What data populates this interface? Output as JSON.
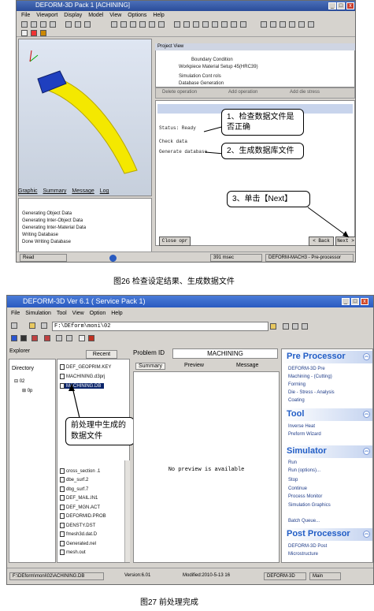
{
  "fig26": {
    "title": "DEFORM-3D  Pack  1  [ACHINING]",
    "menu": [
      "File",
      "Viewport",
      "Display",
      "Model",
      "View",
      "Options",
      "Help"
    ],
    "project_view": {
      "header": "Project View",
      "lines": [
        "Boundary  Condition",
        "Workpiece  Material  Setup  45(HRC39)",
        "Simulation  Cont  rols",
        "Database  Generation"
      ]
    },
    "op_bar": [
      "Delete operation",
      "Add operation",
      "Add die stress"
    ],
    "wizard": {
      "status_label": "Status: Ready",
      "check_label": "Check data",
      "generate_label": "Generate database"
    },
    "callouts": [
      "1、检查数据文件是否正确",
      "2、生成数据库文件",
      "3、单击【Next】"
    ],
    "tabs": [
      "Graphic",
      "Summary",
      "Message",
      "Log"
    ],
    "messages": [
      "Generating  Object  Data",
      "Generating  Inter-Object  Data",
      "Generating  Inter-Material  Data",
      "Writing  Database",
      "Done  Writing  Database"
    ],
    "buttons": {
      "close": "Close opr",
      "back": "< Back",
      "next": "Next >"
    },
    "status": {
      "left": "Read",
      "speed": "391 msec",
      "right": "DEFORM-MACH3  -  Pre-processor"
    },
    "caption": "图26  检查设定结果、生成数据文件"
  },
  "fig27": {
    "title": "DEFORM-3D  Ver  6.1 (  Service  Pack  1)",
    "menu": [
      "File",
      "Simulation",
      "Tool",
      "View",
      "Option",
      "Help"
    ],
    "path": "F:\\DEform\\moni\\02",
    "left_tabs": [
      "Explorer",
      "Recent"
    ],
    "tree_header": "Directory",
    "tree_items": [
      "02",
      "0p"
    ],
    "files_top": [
      "DEF_GEOPRIM.KEY",
      "MACHINING.d3prj",
      "MACHINING.DB"
    ],
    "files_bottom": [
      "cross_section  .1",
      "dbe_surf.2",
      "dbg_surf.7",
      "DEF_MAIL.IN1",
      "DEF_MGN.ACT",
      "DEFORMID.PROB",
      "DENSTY.DST",
      "fmesh3d.dat.D",
      "Generated.nel",
      "mesh.out"
    ],
    "callout": "前处理中生成的数据文件",
    "problem_id_label": "Problem ID",
    "problem_id_value": "MACHINING",
    "center_tabs": [
      "Summary",
      "Preview",
      "Message"
    ],
    "no_preview": "No preview is available",
    "right_sections": [
      {
        "title": "Pre Processor",
        "items": [
          "DEFORM-3D Pre",
          "Machining - (Cutting)",
          "Forming",
          "Die - Stress - Analysis",
          "Coating"
        ]
      },
      {
        "title": "Tool",
        "items": [
          "Inverse  Heat",
          "Preform  Wizard"
        ]
      },
      {
        "title": "Simulator",
        "items": [
          "Run",
          "Run (options)...",
          "Stop",
          "Continue",
          "Process  Monitor",
          "Simulation  Graphics",
          "Batch Queue..."
        ]
      },
      {
        "title": "Post Processor",
        "items": [
          "DEFORM-3D Post",
          "Microstructure"
        ]
      }
    ],
    "status": [
      "F:\\DEform\\moni\\02\\ACHINING.DB",
      "Version:6.01",
      "Modified:2010-5-13 16",
      "DEFORM-3D",
      "Main"
    ],
    "caption": "图27  前处理完成"
  }
}
